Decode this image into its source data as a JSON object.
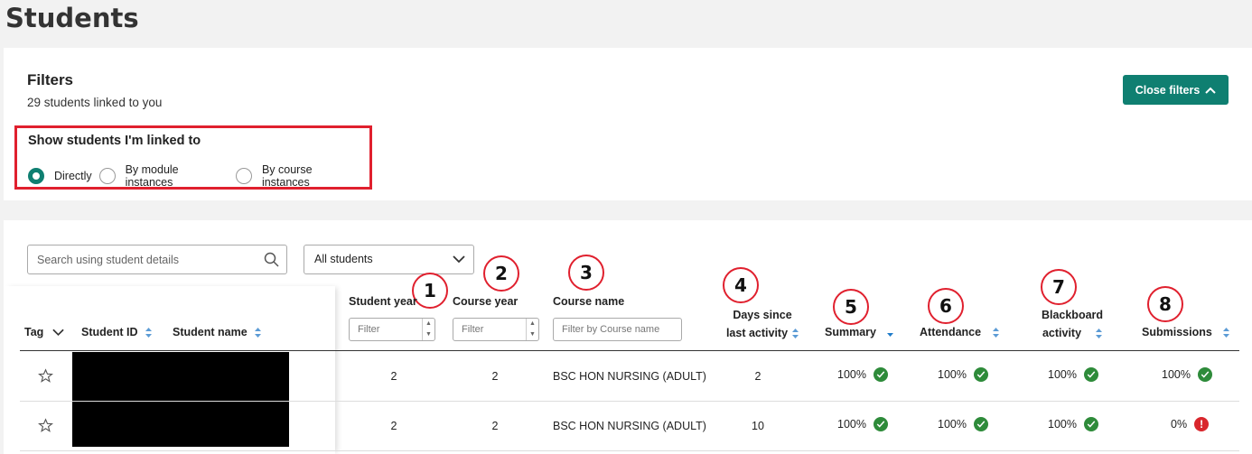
{
  "page": {
    "title": "Students"
  },
  "filters": {
    "title": "Filters",
    "subtitle": "29 students linked to you",
    "close_label": "Close filters",
    "linked": {
      "title": "Show students I'm linked to",
      "options": [
        "Directly",
        "By module instances",
        "By course instances"
      ],
      "selected": "Directly"
    }
  },
  "toolbar": {
    "search_placeholder": "Search using student details",
    "select_value": "All students"
  },
  "annotations": [
    "1",
    "2",
    "3",
    "4",
    "5",
    "6",
    "7",
    "8"
  ],
  "table": {
    "headers": {
      "tag": "Tag",
      "student_id": "Student ID",
      "student_name": "Student name",
      "student_year": "Student year",
      "course_year": "Course year",
      "course_name": "Course name",
      "days_line1": "Days since",
      "days_line2": "last activity",
      "summary": "Summary",
      "attendance": "Attendance",
      "blackboard_line1": "Blackboard",
      "blackboard_line2": "activity",
      "submissions": "Submissions"
    },
    "filter_placeholders": {
      "number": "Filter",
      "course_name": "Filter by Course name"
    },
    "rows": [
      {
        "student_year": "2",
        "course_year": "2",
        "course_name": "BSC HON NURSING (ADULT)",
        "days": "2",
        "summary": "100%",
        "attendance": "100%",
        "blackboard": "100%",
        "submissions": "100%",
        "submissions_status": "ok"
      },
      {
        "student_year": "2",
        "course_year": "2",
        "course_name": "BSC HON NURSING (ADULT)",
        "days": "10",
        "summary": "100%",
        "attendance": "100%",
        "blackboard": "100%",
        "submissions": "0%",
        "submissions_status": "warning"
      }
    ]
  },
  "colors": {
    "accent": "#0f7f71",
    "highlight": "#e0202e",
    "ok": "#2e8b3a",
    "warning": "#d9262c",
    "sort": "#5b9bd5"
  }
}
